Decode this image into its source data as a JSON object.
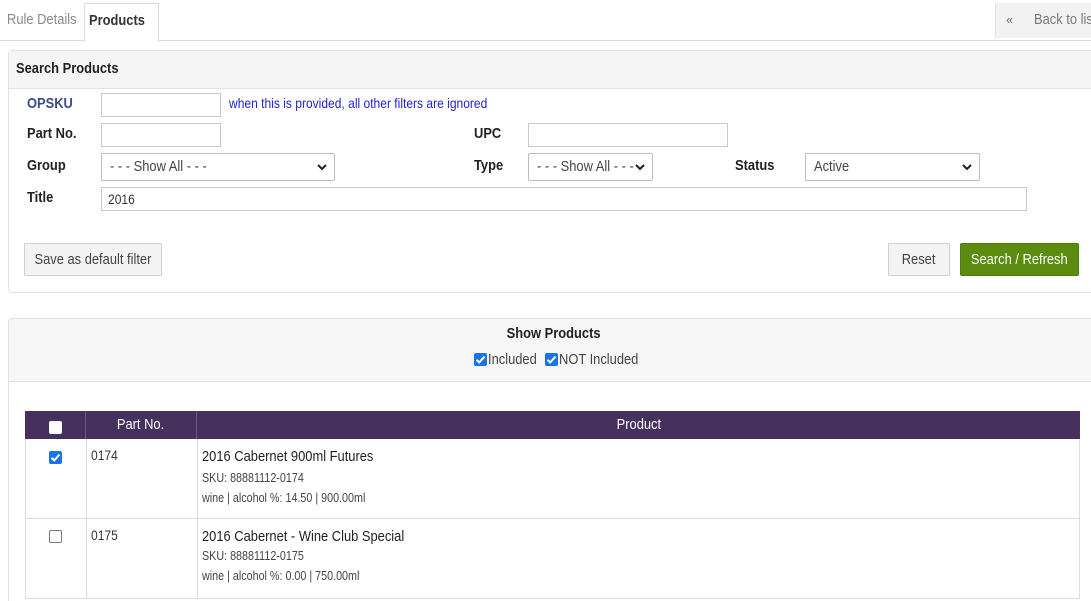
{
  "tabs": {
    "rule_details": "Rule Details",
    "products": "Products",
    "back_arrow": "«",
    "back_label": "Back to list"
  },
  "search": {
    "heading": "Search Products",
    "opsku_label": "OPSKU",
    "opsku_value": "",
    "opsku_hint": "when this is provided, all other filters are ignored",
    "partno_label": "Part No.",
    "partno_value": "",
    "upc_label": "UPC",
    "upc_value": "",
    "group_label": "Group",
    "group_value": "- - - Show All - - -",
    "type_label": "Type",
    "type_value": "- - - Show All - - -",
    "status_label": "Status",
    "status_value": "Active",
    "title_label": "Title",
    "title_value": "2016",
    "save_default": "Save as default filter",
    "reset": "Reset",
    "search_refresh": "Search / Refresh"
  },
  "show_products": {
    "heading": "Show Products",
    "included_label": "Included",
    "included_checked": true,
    "not_included_label": "NOT Included",
    "not_included_checked": true
  },
  "table": {
    "columns": [
      "Part No.",
      "Product"
    ],
    "rows": [
      {
        "checked": true,
        "part_no": "0174",
        "title": "2016 Cabernet 900ml Futures",
        "sku": "SKU: 88881112-0174",
        "details": "wine | alcohol %: 14.50 | 900.00ml"
      },
      {
        "checked": false,
        "part_no": "0175",
        "title": "2016 Cabernet - Wine Club Special",
        "sku": "SKU: 88881112-0175",
        "details": "wine | alcohol %: 0.00 | 750.00ml"
      }
    ]
  },
  "colors": {
    "header_purple": "#46305e",
    "search_green": "#5b8c10",
    "hint_blue": "#2323c9",
    "checkbox_blue": "#1a73e8"
  }
}
